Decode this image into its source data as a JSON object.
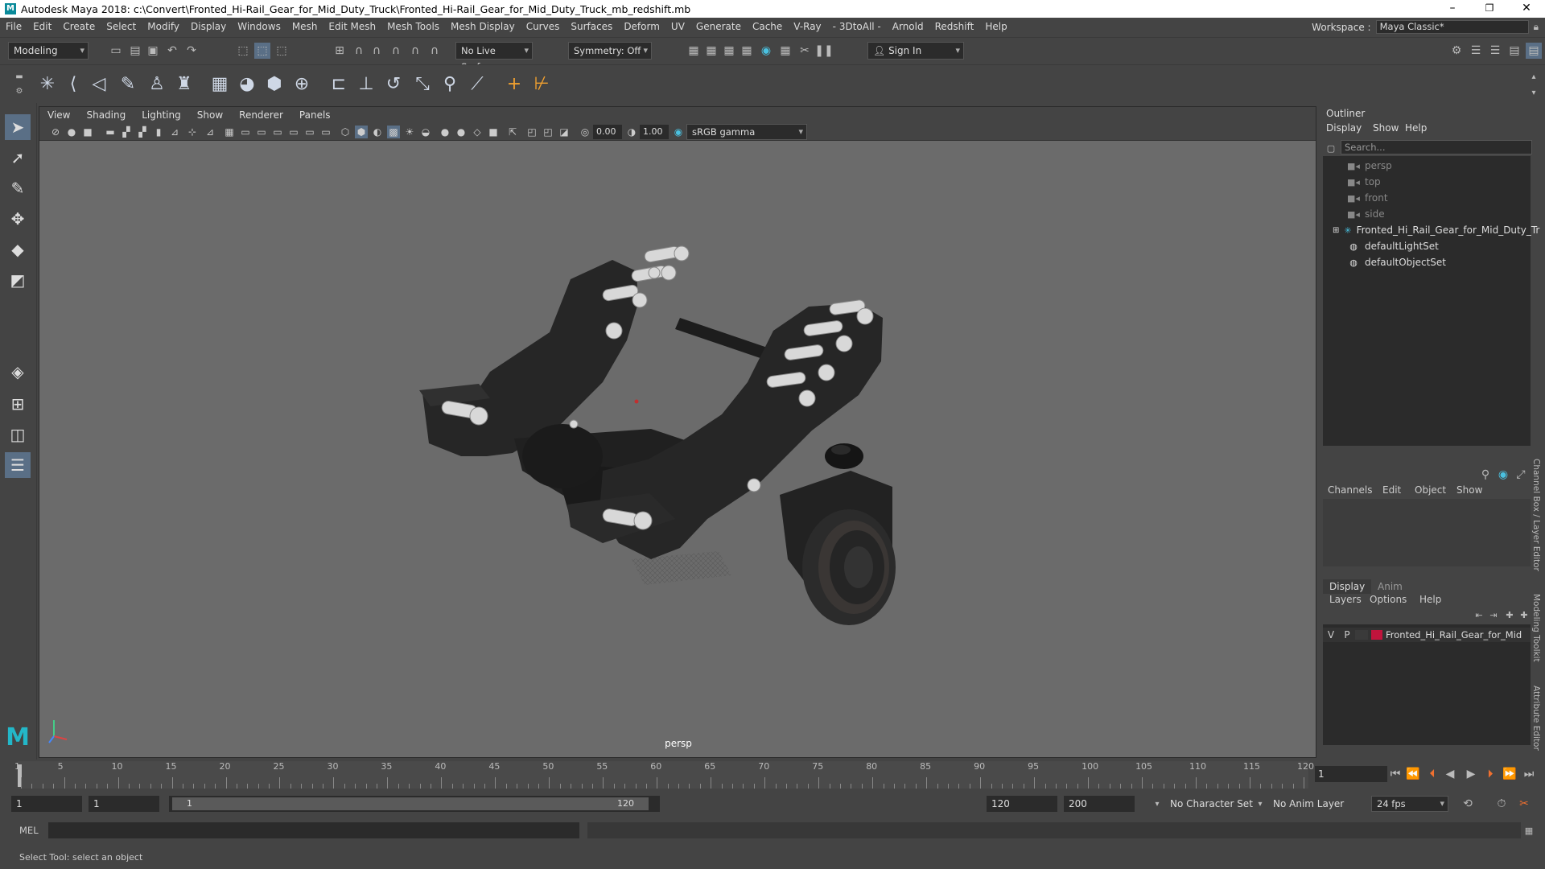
{
  "window": {
    "title": "Autodesk Maya 2018: c:\\Convert\\Fronted_Hi-Rail_Gear_for_Mid_Duty_Truck\\Fronted_Hi-Rail_Gear_for_Mid_Duty_Truck_mb_redshift.mb",
    "minimize": "–",
    "maximize": "❐",
    "close": "✕"
  },
  "menu": [
    "File",
    "Edit",
    "Create",
    "Select",
    "Modify",
    "Display",
    "Windows",
    "Mesh",
    "Edit Mesh",
    "Mesh Tools",
    "Mesh Display",
    "Curves",
    "Surfaces",
    "Deform",
    "UV",
    "Generate",
    "Cache",
    "V-Ray",
    "- 3DtoAll -",
    "Arnold",
    "Redshift",
    "Help"
  ],
  "workspace": {
    "label": "Workspace :",
    "value": "Maya Classic*"
  },
  "statusline": {
    "mode": "Modeling",
    "live_surface": "No Live Surface",
    "symmetry": "Symmetry: Off",
    "sign_in": "Sign In"
  },
  "viewport": {
    "menu": [
      "View",
      "Shading",
      "Lighting",
      "Show",
      "Renderer",
      "Panels"
    ],
    "exposure": "0.00",
    "gamma": "1.00",
    "color_space": "sRGB gamma",
    "camera_label": "persp"
  },
  "outliner": {
    "title": "Outliner",
    "menu": [
      "Display",
      "Show",
      "Help"
    ],
    "search_placeholder": "Search...",
    "items": [
      {
        "label": "persp",
        "icon": "camera-icon",
        "dim": true
      },
      {
        "label": "top",
        "icon": "camera-icon",
        "dim": true
      },
      {
        "label": "front",
        "icon": "camera-icon",
        "dim": true
      },
      {
        "label": "side",
        "icon": "camera-icon",
        "dim": true
      },
      {
        "label": "Fronted_Hi_Rail_Gear_for_Mid_Duty_Tru",
        "icon": "group-icon",
        "dim": false
      },
      {
        "label": "defaultLightSet",
        "icon": "set-icon",
        "dim": false
      },
      {
        "label": "defaultObjectSet",
        "icon": "set-icon",
        "dim": false
      }
    ]
  },
  "channel_box": {
    "menu": [
      "Channels",
      "Edit",
      "Object",
      "Show"
    ]
  },
  "layer_editor": {
    "tabs": [
      "Display",
      "Anim"
    ],
    "menu": [
      "Layers",
      "Options",
      "Help"
    ],
    "layer": {
      "v": "V",
      "p": "P",
      "name": "Fronted_Hi_Rail_Gear_for_Mid",
      "color": "#c0143c"
    }
  },
  "side_tabs": [
    "Channel Box / Layer Editor",
    "Modeling Toolkit",
    "Attribute Editor"
  ],
  "timeline": {
    "ticks": [
      "1",
      "5",
      "10",
      "15",
      "20",
      "25",
      "30",
      "35",
      "40",
      "45",
      "50",
      "55",
      "60",
      "65",
      "70",
      "75",
      "80",
      "85",
      "90",
      "95",
      "100",
      "105",
      "110",
      "115",
      "120"
    ],
    "current_frame": "1"
  },
  "range": {
    "start": "1",
    "anim_start": "1",
    "slider_start": "1",
    "slider_end": "120",
    "end": "120",
    "anim_end": "200",
    "character_set": "No Character Set",
    "anim_layer": "No Anim Layer",
    "fps": "24 fps"
  },
  "command_line": {
    "label": "MEL"
  },
  "help_line": "Select Tool: select an object"
}
